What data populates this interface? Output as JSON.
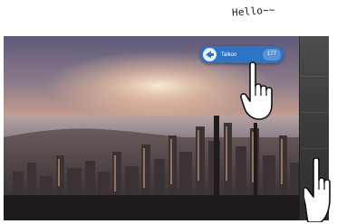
{
  "caption": {
    "text": "Hello~~"
  },
  "talk_button": {
    "label": "Talkon",
    "count": "177",
    "icon": "talk-arrow-icon"
  },
  "scene": {
    "description_icon": "city-skyline-photo"
  },
  "gestures": {
    "top_hand_icon": "tap-hand-icon",
    "side_hand_icon": "swipe-hand-icon"
  }
}
